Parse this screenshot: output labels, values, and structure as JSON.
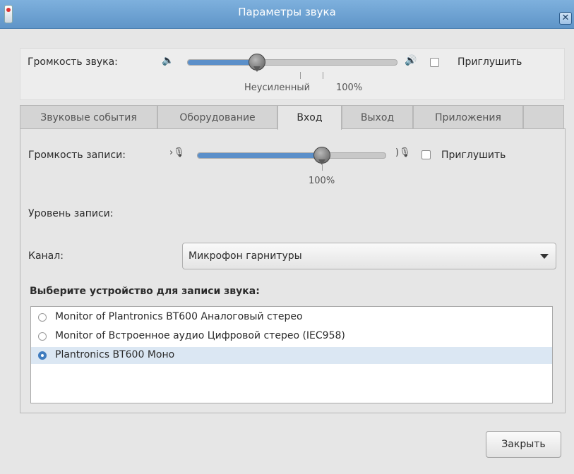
{
  "window": {
    "title": "Параметры звука",
    "close_glyph": "✕",
    "icon": "app-icon"
  },
  "master": {
    "label": "Громкость звука:",
    "low_icon": "🔈",
    "high_icon": "🔊",
    "value_percent": 33,
    "mark_unamplified": "Неусиленный",
    "mark_100": "100%",
    "mute_label": "Приглушить",
    "mute_checked": false
  },
  "tabs": [
    {
      "label": "Звуковые события"
    },
    {
      "label": "Оборудование"
    },
    {
      "label": "Вход"
    },
    {
      "label": "Выход"
    },
    {
      "label": "Приложения"
    }
  ],
  "input": {
    "record_volume_label": "Громкость записи:",
    "mic_low_icon": "›🎙",
    "mic_high_icon": ")🎙",
    "value_percent": 66,
    "mark_100": "100%",
    "mute_label": "Приглушить",
    "mute_checked": false,
    "record_level_label": "Уровень записи:",
    "channel_label": "Канал:",
    "channel_value": "Микрофон гарнитуры",
    "device_heading": "Выберите устройство для записи звука:",
    "devices": [
      {
        "label": "Monitor of Plantronics BT600 Аналоговый стерео",
        "selected": false
      },
      {
        "label": "Monitor of Встроенное аудио Цифровой стерео (IEC958)",
        "selected": false
      },
      {
        "label": "Plantronics BT600 Моно",
        "selected": true
      }
    ]
  },
  "buttons": {
    "close_label": "Закрыть"
  },
  "colors": {
    "titlebar": "#6a9fd2",
    "slider_fill": "#5b8fc9",
    "selection": "#dbe7f3"
  }
}
